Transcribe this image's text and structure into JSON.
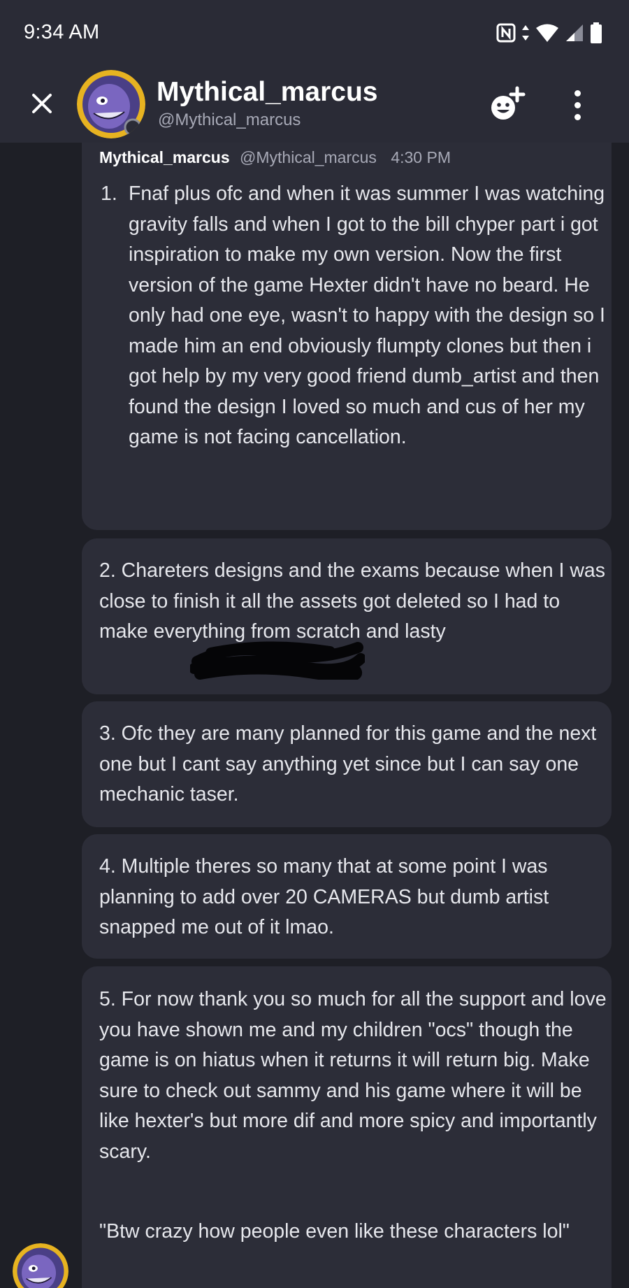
{
  "status_bar": {
    "time": "9:34 AM"
  },
  "header": {
    "title": "Mythical_marcus",
    "subtitle": "@Mythical_marcus"
  },
  "message": {
    "author": "Mythical_marcus",
    "handle": "@Mythical_marcus",
    "timestamp": "4:30 PM",
    "item1_number": "1.",
    "item1_text": "Fnaf plus ofc and when it was summer I was watching gravity falls and when I got to the bill chyper part i got inspiration to make my own version.  Now the first version of the game Hexter didn't have no beard. He only had one eye, wasn't to happy with the design so I made him an end obviously flumpty clones but then i got help by my very good friend dumb_artist and then found the design I loved so much and cus of her my game is not facing cancellation.",
    "item2_text": "2. Chareters designs and the exams because when I was close to finish it all the assets got deleted so I had to make everything from scratch and lasty",
    "item3_text": "3. Ofc they are many planned for this game and the next one but I cant say anything yet since but I can say one mechanic taser.",
    "item4_text": "4. Multiple theres so many that at some point I was planning to add over 20 CAMERAS but dumb artist snapped me out of it lmao.",
    "item5_text": "5. For now thank you so much for all the support and love you have shown me and my children \"ocs\" though the game is on hiatus when it returns it will return big. Make sure to check out sammy and his game where it will be like hexter's but more dif and more spicy and importantly scary.",
    "item5_quote": "\"Btw crazy how people even like these characters lol\""
  },
  "icons": {
    "close": "close-icon",
    "add_reaction": "add-reaction-icon",
    "more": "more-options-icon",
    "nfc": "nfc-icon",
    "data": "data-arrows-icon",
    "wifi": "wifi-icon",
    "signal": "signal-icon",
    "battery": "battery-icon"
  },
  "colors": {
    "background": "#1e1f26",
    "header": "#2a2b36",
    "bubble": "#2c2d38",
    "avatar_ring": "#e7b321",
    "avatar_face": "#6c5aa8"
  }
}
